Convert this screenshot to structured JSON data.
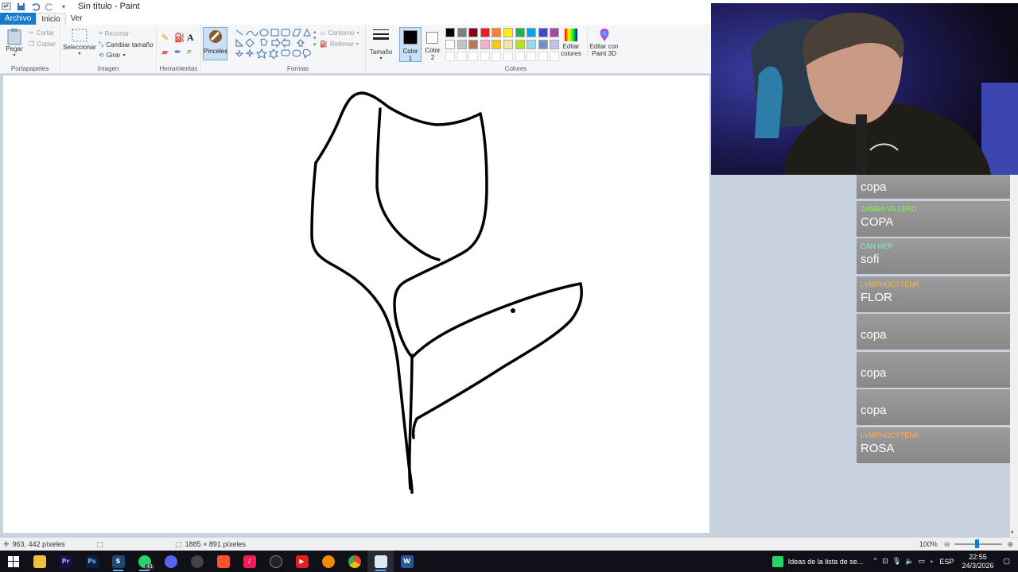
{
  "window": {
    "title": "Sin título - Paint"
  },
  "menu": {
    "file": "Archivo",
    "home": "Inicio",
    "view": "Ver"
  },
  "ribbon": {
    "clipboard": {
      "label": "Portapapeles",
      "paste": "Pegar",
      "cut": "Cortar",
      "copy": "Copiar"
    },
    "image": {
      "label": "Imagen",
      "select": "Seleccionar",
      "crop": "Recortar",
      "resize": "Cambiar tamaño",
      "rotate": "Girar"
    },
    "tools": {
      "label": "Herramientas"
    },
    "brushes": "Pinceles",
    "shapes": {
      "label": "Formas",
      "outline": "Contorno",
      "fill": "Rellenar"
    },
    "size": "Tamaño",
    "color1": "Color 1",
    "color2": "Color 2",
    "colors": {
      "label": "Colores",
      "edit": "Editar colores",
      "row1": [
        "#000000",
        "#7f7f7f",
        "#880015",
        "#ed1c24",
        "#ff7f27",
        "#fff200",
        "#22b14c",
        "#00a2e8",
        "#3f48cc",
        "#a349a4"
      ],
      "row2": [
        "#ffffff",
        "#c3c3c3",
        "#b97a57",
        "#ffaec9",
        "#ffc90e",
        "#efe4b0",
        "#b5e61d",
        "#99d9ea",
        "#7092be",
        "#c8bfe7"
      ]
    },
    "paint3d": "Editar con Paint 3D"
  },
  "chat": [
    {
      "user": "",
      "user_color": "#9fd3ff",
      "text": "copa"
    },
    {
      "user": "ZAMBA VILLERO",
      "user_color": "#7cff4f",
      "text": "COPA"
    },
    {
      "user": "CAN HER",
      "user_color": "#7ef0d8",
      "text": "sofi"
    },
    {
      "user": "LYMPHOCYTENK",
      "user_color": "#ffb347",
      "text": "FLOR"
    },
    {
      "user": "",
      "user_color": "#b59bff",
      "text": "copa"
    },
    {
      "user": "",
      "user_color": "#ffa500",
      "text": "copa"
    },
    {
      "user": "",
      "user_color": "#ffa500",
      "text": "copa"
    },
    {
      "user": "LYMPHOCYTENK",
      "user_color": "#ffb347",
      "text": "ROSA"
    }
  ],
  "status": {
    "cursor": "963, 442 píxeles",
    "canvas_size": "1885 × 891 píxeles",
    "zoom": "100%"
  },
  "taskbar": {
    "notification_text": "Ideas de la lista de se...",
    "whatsapp_badge": "41",
    "language": "ESP",
    "time": "22:55",
    "date": "24/3/2026"
  }
}
